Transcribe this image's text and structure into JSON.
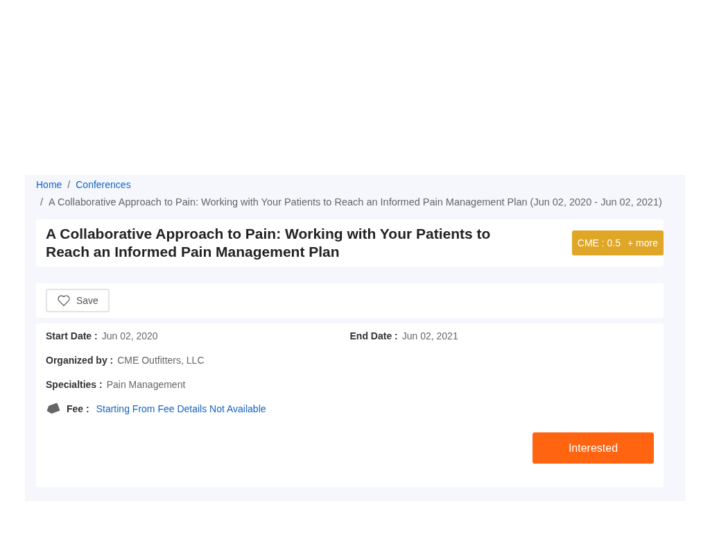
{
  "breadcrumb": {
    "separator": "/",
    "links": [
      "Home",
      "Conferences"
    ],
    "current": "A Collaborative Approach to Pain: Working with Your Patients to Reach an Informed Pain Management Plan (Jun 02, 2020 - Jun 02, 2021)"
  },
  "title": "A Collaborative Approach to Pain: Working with Your Patients to Reach an Informed Pain Management Plan",
  "credit_badge": {
    "label": "CME : 0.5",
    "more": "+ more"
  },
  "save_button": {
    "label": "Save"
  },
  "details": [
    {
      "label": "Start Date :",
      "value": "Jun 02, 2020"
    },
    {
      "label": "End Date :",
      "value": "Jun 02, 2021"
    }
  ],
  "organizer": {
    "label": "Organized by :",
    "value": "CME Outfitters, LLC"
  },
  "specialties": {
    "label": "Specialties :",
    "value": "Pain Management"
  },
  "fee": {
    "label": "Fee :",
    "value": "Starting From Fee Details Not Available"
  },
  "interested_button": {
    "label": "Interested"
  }
}
